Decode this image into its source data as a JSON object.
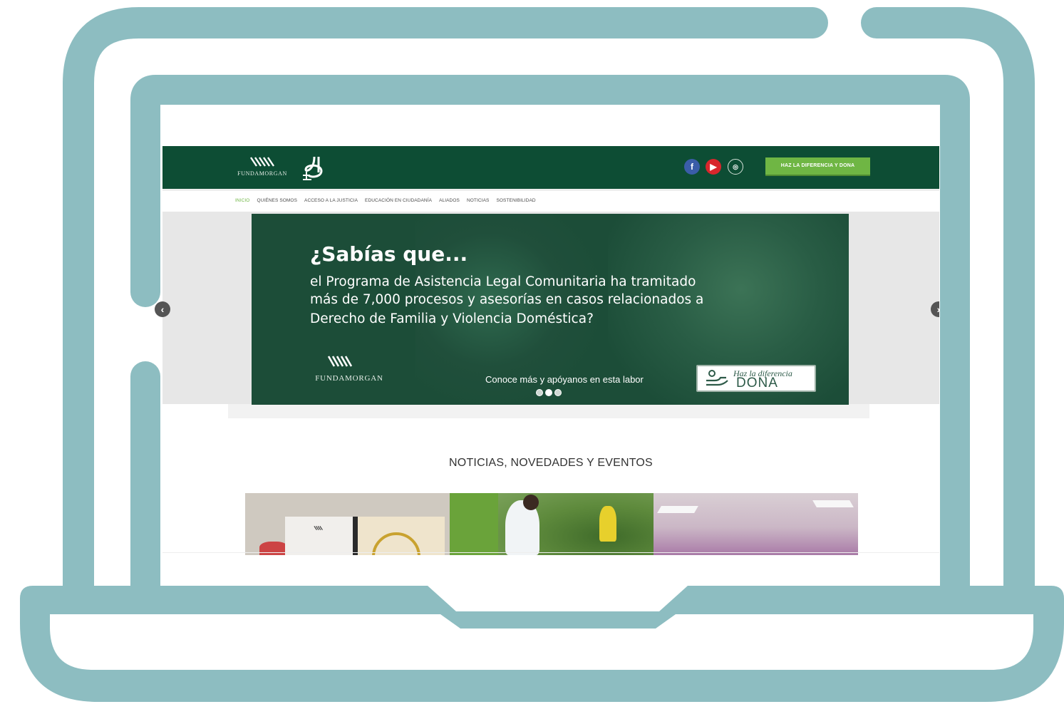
{
  "header": {
    "brand_name": "FUNDAMORGAN",
    "cta_label": "HAZ LA DIFERENCIA Y DONA",
    "social": {
      "facebook_icon": "f",
      "youtube_icon": "▶",
      "instagram_icon": "◎"
    }
  },
  "nav": {
    "items": [
      {
        "label": "INICIO",
        "active": true
      },
      {
        "label": "QUIÉNES SOMOS",
        "active": false
      },
      {
        "label": "ACCESO A LA JUSTICIA",
        "active": false
      },
      {
        "label": "EDUCACIÓN EN CIUDADANÍA",
        "active": false
      },
      {
        "label": "ALIADOS",
        "active": false
      },
      {
        "label": "NOTICIAS",
        "active": false
      },
      {
        "label": "SOSTENIBILIDAD",
        "active": false
      }
    ]
  },
  "slider": {
    "title": "¿Sabías que...",
    "lines": [
      "el Programa de Asistencia Legal Comunitaria ha tramitado",
      "más de 7,000 procesos y asesorías en casos relacionados a",
      "Derecho de Familia y Violencia Doméstica?"
    ],
    "logo_text": "FUNDAMORGAN",
    "cta_text": "Conoce más y apóyanos en esta labor",
    "dona_small": "Haz la diferencia",
    "dona_big": "DONA",
    "dots_total": 3,
    "active_dot": 1,
    "prev_arrow": "‹",
    "next_arrow": "›"
  },
  "news": {
    "title": "NOTICIAS, NOVEDADES Y EVENTOS"
  },
  "colors": {
    "frame": "#8dbdc1",
    "header_green": "#0d4d34",
    "cta_green": "#6fb644"
  }
}
